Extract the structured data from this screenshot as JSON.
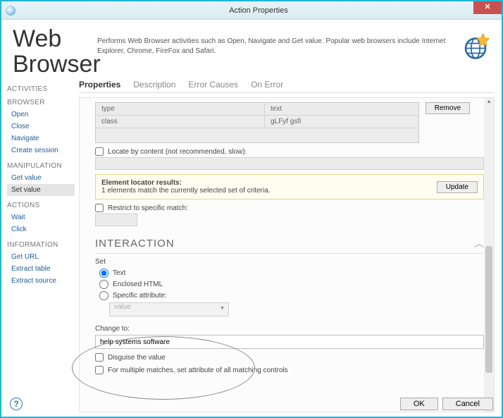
{
  "window": {
    "title": "Action Properties",
    "close_glyph": "✕"
  },
  "header": {
    "title_line1": "Web",
    "title_line2": "Browser",
    "description": "Performs Web Browser activities such as Open, Navigate and Get value. Popular web browsers include Internet Explorer, Chrome, FireFox and Safari."
  },
  "sidebar": {
    "heading": "ACTIVITIES",
    "groups": [
      {
        "label": "BROWSER",
        "items": [
          "Open",
          "Close",
          "Navigate",
          "Create session"
        ]
      },
      {
        "label": "MANIPULATION",
        "items": [
          "Get value",
          "Set value"
        ],
        "selected": "Set value"
      },
      {
        "label": "ACTIONS",
        "items": [
          "Wait",
          "Click"
        ]
      },
      {
        "label": "INFORMATION",
        "items": [
          "Get URL",
          "Extract table",
          "Extract source"
        ]
      }
    ]
  },
  "tabs": {
    "items": [
      "Properties",
      "Description",
      "Error Causes",
      "On Error"
    ],
    "active": "Properties"
  },
  "attrs": {
    "rows": [
      {
        "k": "type",
        "v": "text"
      },
      {
        "k": "class",
        "v": "gLFyf gsfi"
      }
    ],
    "remove": "Remove"
  },
  "locate": {
    "label": "Locate by content (not recommended, slow):"
  },
  "results": {
    "heading": "Element locator results:",
    "text": "1 elements match the currently selected set of criteria.",
    "update": "Update"
  },
  "restrict": {
    "label": "Restrict to specific match:"
  },
  "interaction": {
    "heading": "INTERACTION",
    "set_label": "Set",
    "options": {
      "text": "Text",
      "enclosed": "Enclosed HTML",
      "specific": "Specific attribute:",
      "selected": "text",
      "attr_value": "value"
    },
    "change_label": "Change to:",
    "change_value": "help systems software",
    "disguise": "Disguise the value",
    "multi": "For multiple matches, set attribute of all matching controls"
  },
  "footer": {
    "ok": "OK",
    "cancel": "Cancel",
    "help": "?"
  }
}
